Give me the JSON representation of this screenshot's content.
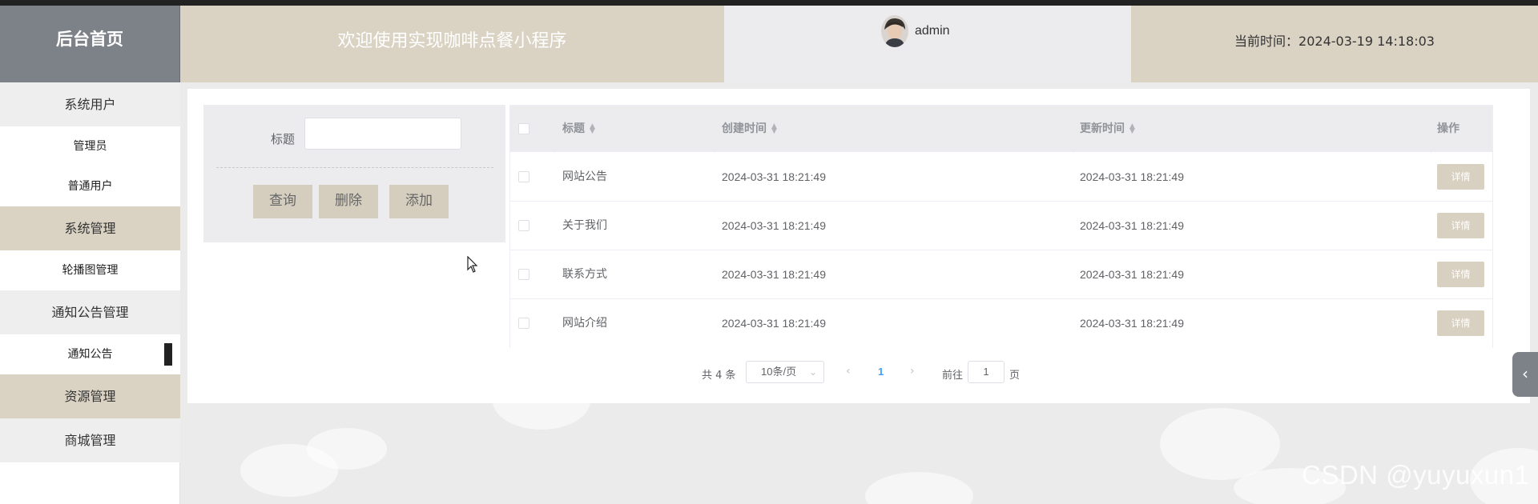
{
  "header": {
    "home_label": "后台首页",
    "welcome": "欢迎使用实现咖啡点餐小程序",
    "username": "admin",
    "current_time": "当前时间：2024-03-19 14:18:03"
  },
  "sidebar": {
    "items": [
      {
        "label": "系统用户",
        "type": "group",
        "style": "light"
      },
      {
        "label": "管理员",
        "type": "sub"
      },
      {
        "label": "普通用户",
        "type": "sub"
      },
      {
        "label": "系统管理",
        "type": "group",
        "style": "tan"
      },
      {
        "label": "轮播图管理",
        "type": "sub"
      },
      {
        "label": "通知公告管理",
        "type": "group",
        "style": "light"
      },
      {
        "label": "通知公告",
        "type": "sub",
        "active": true
      },
      {
        "label": "资源管理",
        "type": "group",
        "style": "tan"
      },
      {
        "label": "商城管理",
        "type": "group",
        "style": "light"
      }
    ]
  },
  "search": {
    "title_label": "标题",
    "title_value": "",
    "query_label": "查询",
    "delete_label": "删除",
    "add_label": "添加"
  },
  "table": {
    "columns": [
      "标题",
      "创建时间",
      "更新时间",
      "操作"
    ],
    "rows": [
      {
        "title": "网站公告",
        "created": "2024-03-31 18:21:49",
        "updated": "2024-03-31 18:21:49",
        "action": "详情"
      },
      {
        "title": "关于我们",
        "created": "2024-03-31 18:21:49",
        "updated": "2024-03-31 18:21:49",
        "action": "详情"
      },
      {
        "title": "联系方式",
        "created": "2024-03-31 18:21:49",
        "updated": "2024-03-31 18:21:49",
        "action": "详情"
      },
      {
        "title": "网站介绍",
        "created": "2024-03-31 18:21:49",
        "updated": "2024-03-31 18:21:49",
        "action": "详情"
      }
    ]
  },
  "pagination": {
    "total": "共 4 条",
    "page_size": "10条/页",
    "current_page": "1",
    "goto_label": "前往",
    "goto_value": "1",
    "page_suffix": "页"
  },
  "watermark": "CSDN @yuyuxun1",
  "colors": {
    "tan": "#dad3c4",
    "grey_header": "#7d8188",
    "light": "#ececee",
    "link_blue": "#409eff"
  }
}
